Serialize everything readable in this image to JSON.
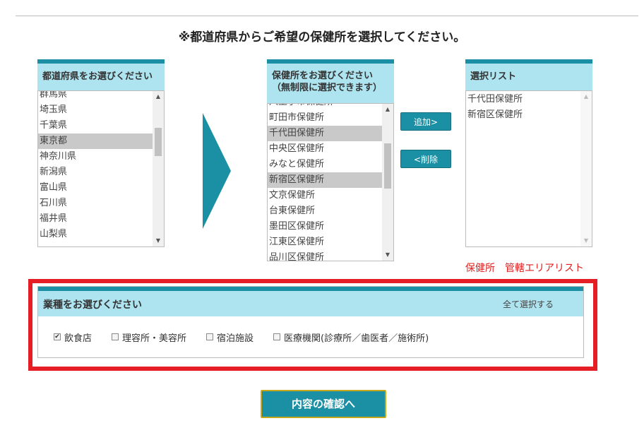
{
  "page_title": "※都道府県からご希望の保健所を選択してください。",
  "prefecture_panel": {
    "header": "都道府県をお選びください",
    "items": [
      "群馬県",
      "埼玉県",
      "千葉県",
      "東京都",
      "神奈川県",
      "新潟県",
      "富山県",
      "石川県",
      "福井県",
      "山梨県"
    ],
    "selected": "東京都"
  },
  "health_center_panel": {
    "header_line1": "保健所をお選びください",
    "header_line2": "（無制限に選択できます）",
    "items": [
      "八王子市保健所",
      "町田市保健所",
      "千代田保健所",
      "中央区保健所",
      "みなと保健所",
      "新宿区保健所",
      "文京保健所",
      "台東保健所",
      "墨田区保健所",
      "江東区保健所",
      "品川区保健所"
    ],
    "selected": [
      "千代田保健所",
      "新宿区保健所"
    ]
  },
  "buttons": {
    "add": "追加>",
    "remove": "<削除",
    "confirm": "内容の確認へ"
  },
  "selection_panel": {
    "header": "選択リスト",
    "items": [
      "千代田保健所",
      "新宿区保健所"
    ]
  },
  "area_list_link": "保健所　管轄エリアリスト",
  "industry": {
    "header": "業種をお選びください",
    "select_all": "全て選択する",
    "options": [
      {
        "label": "飲食店",
        "checked": true
      },
      {
        "label": "理容所・美容所",
        "checked": false
      },
      {
        "label": "宿泊施設",
        "checked": false
      },
      {
        "label": "医療機関(診療所／歯医者／施術所)",
        "checked": false
      }
    ]
  },
  "colors": {
    "accent": "#1b8fa3",
    "header_bg": "#aee4f0",
    "highlight_frame": "#e51d25",
    "link": "#e02020"
  }
}
